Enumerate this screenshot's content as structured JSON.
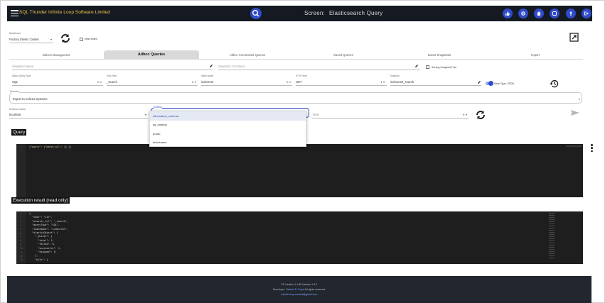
{
  "header": {
    "app_title": "SQL Thunder Infinite Loop Software Limited",
    "screen_label": "Screen:",
    "screen_name": "Elasticsearch Query",
    "icons": [
      "thumb-icon",
      "settings-icon",
      "home-icon",
      "database-icon",
      "upload-icon",
      "logout-icon"
    ]
  },
  "connection": {
    "label": "Dashboard",
    "value": "Factory Elastic Cluster",
    "new_index_label": "New index"
  },
  "tabs": [
    "Indices Management",
    "Adhoc Queries",
    "Adhoc Commands Queries",
    "Saved Queries",
    "Saved Snapshots",
    "Import"
  ],
  "active_tab": 1,
  "snapshot": {
    "name_placeholder": "Snapshot Name",
    "comment_placeholder": "Snapshot Comment",
    "checkbox_label": "Sorting Snapshot? No"
  },
  "params": {
    "query_type_label": "Adhoc Query Type",
    "query_type_value": "SQL",
    "endpoint_label": "End-Point",
    "endpoint_value": "_search",
    "index_label": "Index Name",
    "index_value": "indexrest",
    "http_label": "HTTP Verb",
    "http_value": "GET",
    "endpoint2_label": "Endpoint",
    "endpoint2_value": "indexrest/_search",
    "view_type_label": "View Type: JSON"
  },
  "describe": {
    "label": "Describe",
    "value": "Export to Indices Systems"
  },
  "schema_row": {
    "schema_ctrl_label": "Schema Control",
    "schema_ctrl_value": "localhost",
    "schema_label": "Schema",
    "schema_value": "",
    "table_placeholder": "Table"
  },
  "dropdown": {
    "options": [
      "information_schema",
      "pg_catalog",
      "public",
      "tests/name"
    ],
    "selected": 0
  },
  "query_section": {
    "title": "Query",
    "code": "{\"query\": {\"match_all\": {} }}"
  },
  "result_section": {
    "title": "Execution result (read only)",
    "lines": [
      "{",
      "  \"took\": \"127\",",
      "  \"elastic_url\": \"_search\",",
      "  \"queryType\": \"SQL\",",
      "  \"indexName\": \"indexrest\",",
      "  \"elasticObject\": {",
      "    \"_shards\": {",
      "      \"total\": 1,",
      "      \"failed\": 0,",
      "      \"successful\": 1,",
      "      \"skipped\": 0",
      "    },",
      "    \"hits\": {"
    ]
  },
  "footer": {
    "version": "FE Version 1.1.88 Version 1.3.2",
    "developer_prefix": "Developer:",
    "developer_name": "Gabriel R. Popa",
    "rights": "All rights reserved.",
    "email": "infinite.loop.contact@gmail.com"
  }
}
